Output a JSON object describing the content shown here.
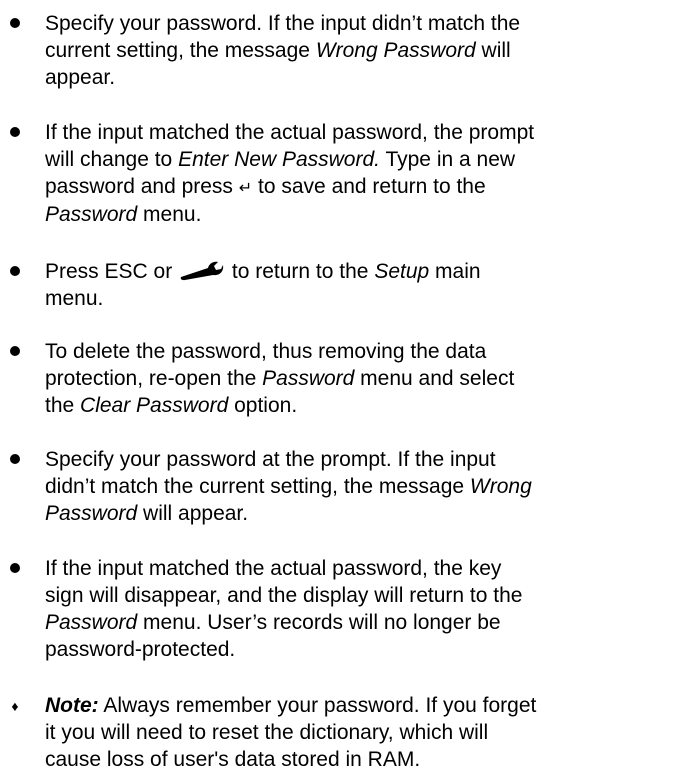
{
  "bullets": [
    {
      "id": "b1",
      "lines": [
        "Specify your password. If the input didn’t match the",
        [
          "current setting, the message ",
          {
            "i": "Wrong Password"
          },
          " will"
        ],
        "appear."
      ]
    },
    {
      "id": "b2",
      "lines": [
        "If the input matched the actual password, the prompt",
        [
          "will change to ",
          {
            "i": "Enter New Password."
          },
          " Type in a new"
        ],
        [
          "password and press ",
          {
            "g": "↵"
          },
          " to save and return to the"
        ],
        [
          {
            "i": "Password"
          },
          " menu."
        ]
      ]
    },
    {
      "id": "b3",
      "lines": [
        [
          "Press ESC or ",
          {
            "icon": "wrench-icon"
          },
          " to return to the ",
          {
            "i": "Setup"
          },
          " main"
        ],
        "menu."
      ]
    },
    {
      "id": "b4",
      "lines": [
        "To delete the password, thus removing the data",
        [
          "protection, re-open the ",
          {
            "i": "Password"
          },
          " menu and select"
        ],
        [
          "the ",
          {
            "i": "Clear Password"
          },
          " option."
        ]
      ]
    },
    {
      "id": "b5",
      "lines": [
        "Specify your password at the prompt. If the input",
        [
          "didn’t match the current setting, the message ",
          {
            "i": "Wrong"
          }
        ],
        [
          {
            "i": "Password"
          },
          " will appear."
        ]
      ]
    },
    {
      "id": "b6",
      "lines": [
        "If the input matched the actual password, the key",
        "sign will disappear, and the display will return to the",
        [
          {
            "i": "Password"
          },
          " menu. User’s records will no longer be"
        ],
        "password-protected."
      ]
    }
  ],
  "note": {
    "id": "note",
    "lines": [
      [
        {
          "bi": "Note:"
        },
        " Always remember your password. If you forget"
      ],
      "it you will need to reset the dictionary, which will",
      "cause loss of user's data stored in RAM."
    ]
  }
}
